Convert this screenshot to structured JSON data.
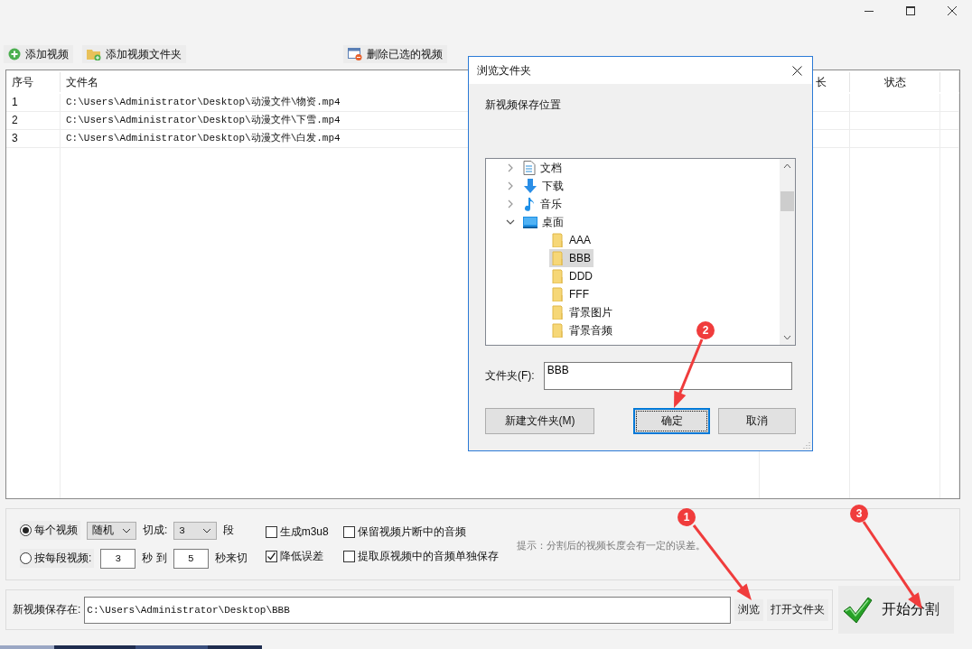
{
  "toolbar": [
    {
      "label": "添加视频"
    },
    {
      "label": "添加视频文件夹"
    },
    {
      "label": "删除已选的视频"
    }
  ],
  "table": {
    "columns": [
      "序号",
      "文件名",
      "长",
      "状态"
    ],
    "rows": [
      [
        "1",
        "C:\\Users\\Administrator\\Desktop\\动漫文件\\物资.mp4"
      ],
      [
        "2",
        "C:\\Users\\Administrator\\Desktop\\动漫文件\\下雪.mp4"
      ],
      [
        "3",
        "C:\\Users\\Administrator\\Desktop\\动漫文件\\白发.mp4"
      ]
    ]
  },
  "options": {
    "mode_each": {
      "label": "每个视频",
      "selected": true,
      "method": "随机",
      "cut_label": "切成:",
      "count": "3",
      "unit": "段"
    },
    "mode_range": {
      "label": "按每段视频:",
      "selected": false,
      "from": "3",
      "sep": "秒 到",
      "to": "5",
      "unit": "秒来切"
    },
    "checkboxes": [
      {
        "label": "生成m3u8",
        "checked": false
      },
      {
        "label": "保留视频片断中的音频",
        "checked": false
      },
      {
        "label": "降低误差",
        "checked": true
      },
      {
        "label": "提取原视频中的音频单独保存",
        "checked": false
      }
    ],
    "hint": "提示：分割后的视频长度会有一定的误差。"
  },
  "save": {
    "label": "新视频保存在:",
    "path": "C:\\Users\\Administrator\\Desktop\\BBB",
    "browse": "浏览",
    "open": "打开文件夹",
    "start": "开始分割"
  },
  "dialog": {
    "title": "浏览文件夹",
    "prompt": "新视频保存位置",
    "tree": [
      {
        "label": "文档",
        "kind": "document",
        "expanded": false,
        "selected": false
      },
      {
        "label": "下载",
        "kind": "download",
        "expanded": false,
        "selected": false
      },
      {
        "label": "音乐",
        "kind": "music",
        "expanded": false,
        "selected": false
      },
      {
        "label": "桌面",
        "kind": "desktop",
        "expanded": true,
        "selected": false,
        "children": [
          {
            "label": "AAA",
            "kind": "folder",
            "selected": false
          },
          {
            "label": "BBB",
            "kind": "folder",
            "selected": true
          },
          {
            "label": "DDD",
            "kind": "folder",
            "selected": false
          },
          {
            "label": "FFF",
            "kind": "folder",
            "selected": false
          },
          {
            "label": "背景图片",
            "kind": "folder",
            "selected": false
          },
          {
            "label": "背景音频",
            "kind": "folder",
            "selected": false
          }
        ]
      }
    ],
    "folder_label": "文件夹(F):",
    "folder_value": "BBB",
    "buttons": [
      "新建文件夹(M)",
      "确定",
      "取消"
    ]
  },
  "annotations": [
    "1",
    "2",
    "3"
  ]
}
